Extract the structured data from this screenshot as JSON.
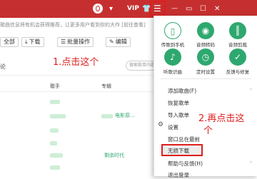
{
  "topbar": {
    "vip_label": "VIP",
    "menu_icon": "☰",
    "minimize_icon": "—",
    "maximize_icon": "☐",
    "close_icon": "✕"
  },
  "notice_text": "歌曲信息将有机会获得推荐，让更多用户看到你的大作 [前往查看]",
  "toolbar": {
    "all_label": "全部",
    "download_label": "下载",
    "batch_label": "批量操作",
    "edit_label": "编辑"
  },
  "table": {
    "header_left": "论",
    "header_singer": "歌手",
    "header_album": "专辑",
    "search_placeholder": "搜索歌单内歌曲"
  },
  "rows": [
    {
      "album": "电影原..."
    },
    {
      "album": "剩余时代"
    }
  ],
  "annotations": {
    "step1": "1.点击这个",
    "step2_line1": "2.再点击这",
    "step2_line2": "个"
  },
  "menu": {
    "grid": [
      {
        "label": "传歌到手机",
        "icon": "phone-icon"
      },
      {
        "label": "音频转码",
        "icon": "record-icon"
      },
      {
        "label": "音频剪裁",
        "icon": "waveform-icon"
      },
      {
        "label": "听歌识曲",
        "icon": "mic-icon"
      },
      {
        "label": "定时设置",
        "icon": "timer-icon"
      },
      {
        "label": "反馈与修复",
        "icon": "shield-icon"
      }
    ],
    "items": [
      {
        "label": "添加歌曲(F)",
        "arrow": "›"
      },
      {
        "label": "恢复歌单",
        "arrow": ""
      },
      {
        "label": "导入歌单",
        "arrow": ""
      },
      {
        "label": "设置",
        "arrow": ""
      },
      {
        "label": "窗口总在最前",
        "arrow": ""
      },
      {
        "label": "无损下载",
        "arrow": ""
      },
      {
        "label": "帮助与反馈(H)",
        "arrow": "›"
      },
      {
        "label": "退出登录",
        "arrow": ""
      }
    ]
  },
  "colors": {
    "brand_red": "#c62f2f",
    "annotation_red": "#e01d1d",
    "icon_green": "#2ea86f"
  }
}
